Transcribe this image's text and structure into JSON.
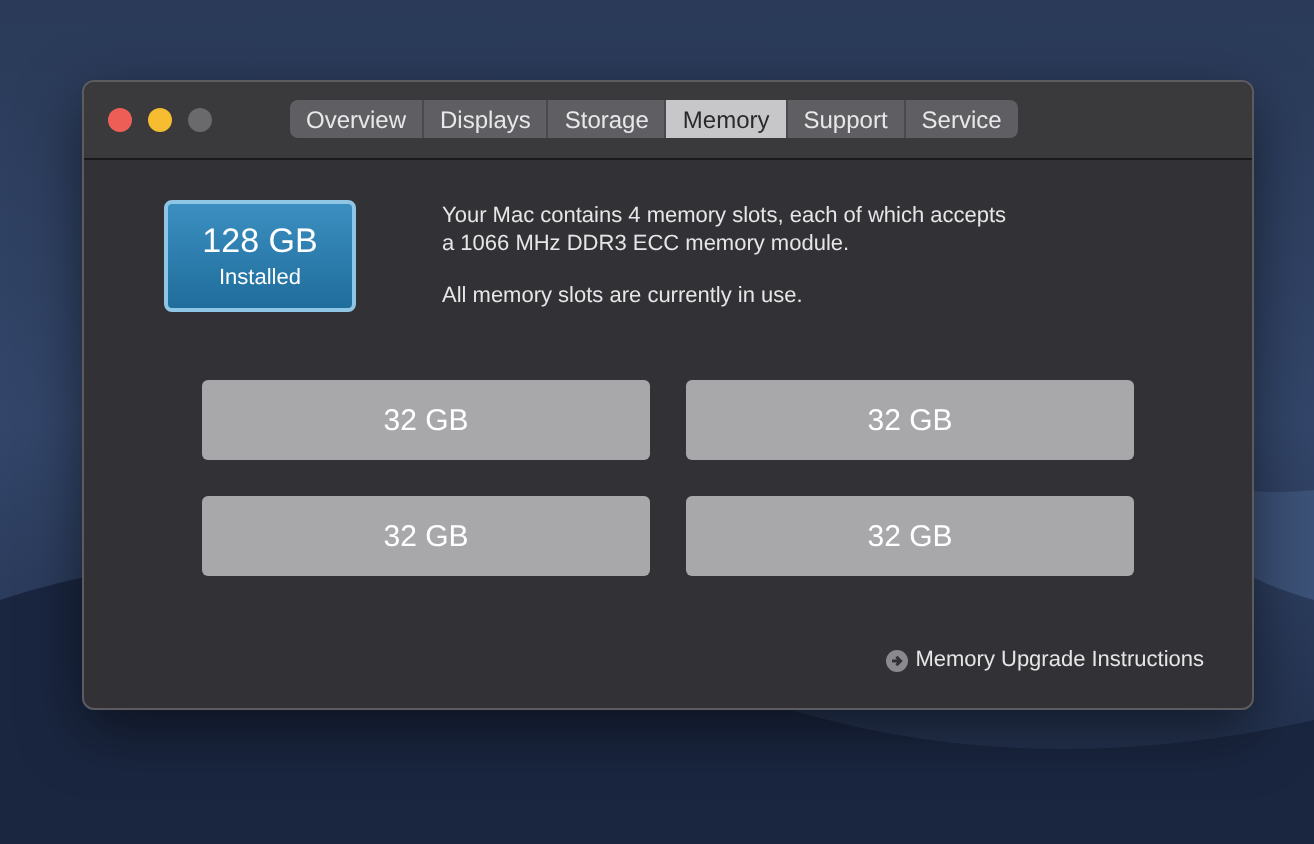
{
  "window": {
    "tabs": [
      {
        "label": "Overview",
        "selected": false
      },
      {
        "label": "Displays",
        "selected": false
      },
      {
        "label": "Storage",
        "selected": false
      },
      {
        "label": "Memory",
        "selected": true
      },
      {
        "label": "Support",
        "selected": false
      },
      {
        "label": "Service",
        "selected": false
      }
    ]
  },
  "summary": {
    "amount": "128 GB",
    "caption": "Installed"
  },
  "description": [
    "Your Mac contains 4 memory slots, each of which accepts a 1066 MHz DDR3 ECC memory module.",
    "All memory slots are currently in use."
  ],
  "slots": [
    "32 GB",
    "32 GB",
    "32 GB",
    "32 GB"
  ],
  "link": "Memory Upgrade Instructions"
}
